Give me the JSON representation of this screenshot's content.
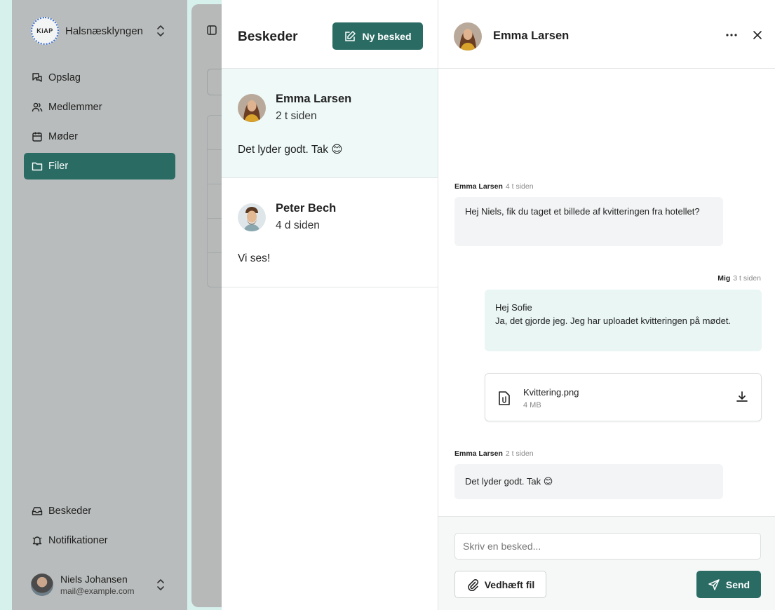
{
  "sidebar": {
    "org_logo_text": "KiAP",
    "org_name": "Halsnæsklyngen",
    "nav": [
      {
        "label": "Opslag",
        "icon": "posts-icon"
      },
      {
        "label": "Medlemmer",
        "icon": "members-icon"
      },
      {
        "label": "Møder",
        "icon": "calendar-icon"
      },
      {
        "label": "Filer",
        "icon": "folder-icon",
        "active": true
      }
    ],
    "nav_bottom": [
      {
        "label": "Beskeder",
        "icon": "inbox-icon"
      },
      {
        "label": "Notifikationer",
        "icon": "bell-icon"
      }
    ],
    "user": {
      "name": "Niels Johansen",
      "email": "mail@example.com"
    }
  },
  "messages_list": {
    "title": "Beskeder",
    "new_button": "Ny besked",
    "conversations": [
      {
        "name": "Emma Larsen",
        "time": "2 t siden",
        "preview": "Det lyder godt. Tak 😊",
        "active": true
      },
      {
        "name": "Peter Bech",
        "time": "4 d siden",
        "preview": "Vi ses!",
        "active": false
      }
    ]
  },
  "chat": {
    "title": "Emma Larsen",
    "messages": [
      {
        "sender": "Emma Larsen",
        "time": "4 t siden",
        "text": "Hej Niels, fik du taget et billede af kvitteringen fra hotellet?",
        "direction": "in"
      },
      {
        "sender": "Mig",
        "time": "3 t siden",
        "lines": [
          "Hej Sofie",
          "Ja, det gjorde jeg. Jeg har uploadet kvitteringen på mødet."
        ],
        "direction": "out",
        "attachment": {
          "name": "Kvittering.png",
          "size": "4 MB"
        }
      },
      {
        "sender": "Emma Larsen",
        "time": "2 t siden",
        "text": "Det lyder godt. Tak 😊",
        "direction": "in"
      }
    ],
    "composer": {
      "placeholder": "Skriv en besked...",
      "attach_label": "Vedhæft fil",
      "send_label": "Send"
    }
  },
  "colors": {
    "primary": "#2a6c64",
    "page_bg": "#d6f0ec",
    "active_conversation": "#eef9f8",
    "outgoing_bubble": "#e9f6f4",
    "incoming_bubble": "#f3f4f5"
  }
}
